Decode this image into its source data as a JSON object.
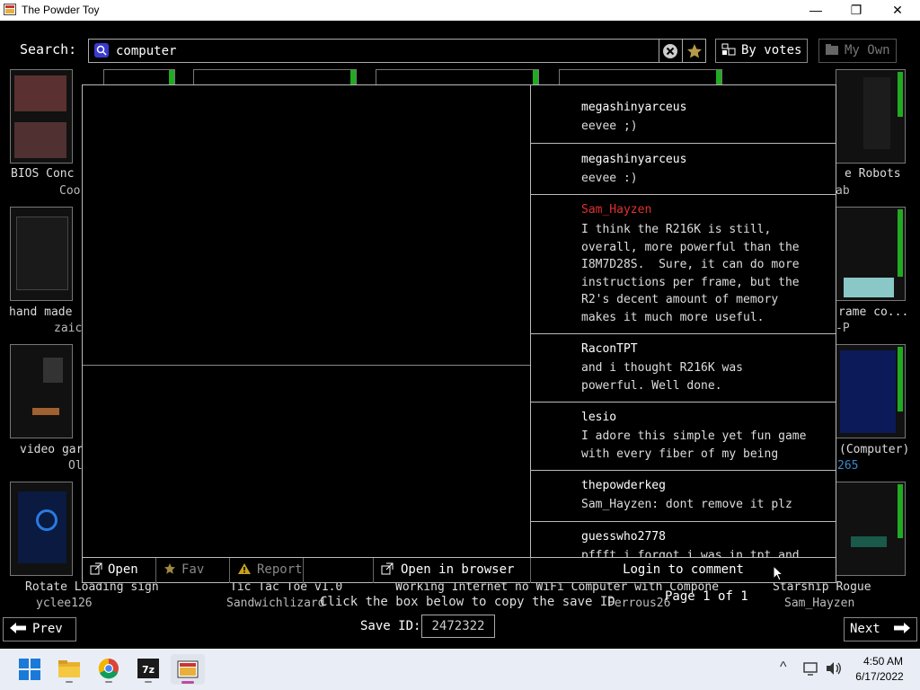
{
  "window": {
    "title": "The Powder Toy",
    "minimize_glyph": "—",
    "maximize_glyph": "❐",
    "close_glyph": "✕"
  },
  "search": {
    "label": "Search:",
    "value": "computer",
    "sort_button": "By votes",
    "my_own_button": "My Own"
  },
  "saves": [
    {
      "title": "BIOS Conc",
      "author": "Coo"
    },
    {
      "title": "hand made",
      "author": "zaic"
    },
    {
      "title": "video gar",
      "author": "Ol"
    },
    {
      "title": "Rotate Loading sign",
      "author": "yclee126"
    },
    {
      "title": "Tic Tac Toe v1.0",
      "author": "Sandwichlizard"
    },
    {
      "title": "Working Internet no WiFi Computer with Components",
      "author": "Ferrous26"
    },
    {
      "title": "Starship Rogue",
      "author": "Sam_Hayzen"
    },
    {
      "title": "e Robots",
      "author": "ab"
    },
    {
      "title": "rame co...",
      "author": "-P"
    },
    {
      "title": "(Computer)",
      "author": "265"
    }
  ],
  "comments": [
    {
      "author": "megashinyarceus",
      "text": "eevee ;)"
    },
    {
      "author": "megashinyarceus",
      "text": "eevee :)"
    },
    {
      "author": "Sam_Hayzen",
      "text": "I think the R216K is still,\noverall, more powerful than the\nI8M7D28S.  Sure, it can do more\ninstructions per frame, but the\nR2's decent amount of memory\nmakes it much more useful."
    },
    {
      "author": "RaconTPT",
      "text": "and i thought R216K was\npowerful. Well done."
    },
    {
      "author": "lesio",
      "text": "I adore this simple yet fun game\nwith every fiber of my being"
    },
    {
      "author": "thepowderkeg",
      "text": "Sam_Hayzen: dont remove it plz"
    },
    {
      "author": "guesswho2778",
      "text": "pffft i forgot i was in tpt and"
    }
  ],
  "preview_buttons": {
    "open": "Open",
    "fav": "Fav",
    "report": "Report",
    "open_browser": "Open in browser",
    "login": "Login to comment"
  },
  "footer": {
    "copy_hint": "Click the box below to copy the save ID",
    "save_id_label": "Save ID:",
    "save_id": "2472322",
    "page_info": "Page 1 of 1",
    "prev": "Prev",
    "next": "Next"
  },
  "taskbar": {
    "time": "4:50 AM",
    "date": "6/17/2022",
    "chevron": "^"
  },
  "colors": {
    "highlight_name": "#e03030",
    "vote_bar": "#22aa22",
    "taskbar_bg": "#e9eef6"
  }
}
